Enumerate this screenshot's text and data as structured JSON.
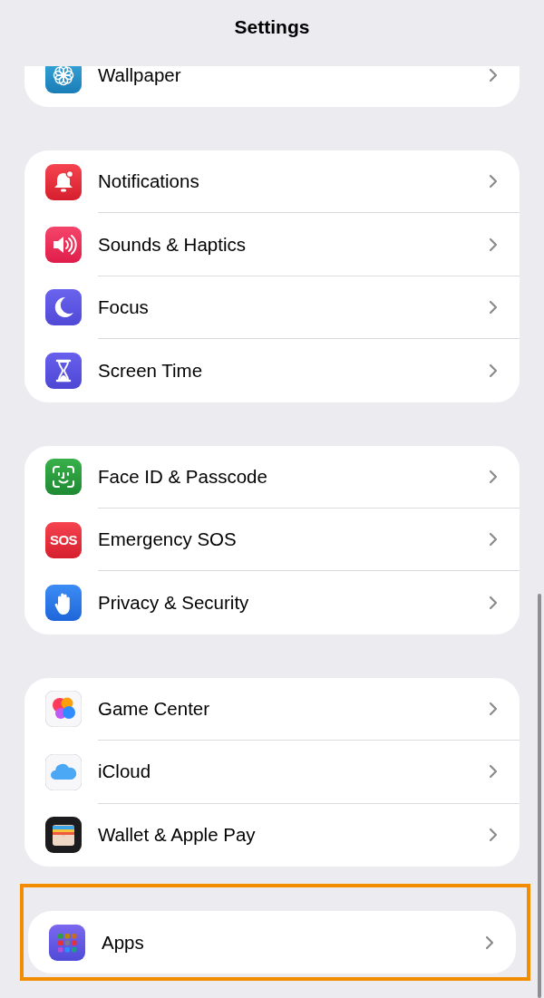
{
  "title": "Settings",
  "groups": [
    {
      "clipped_top": true,
      "highlighted": false,
      "rows": [
        {
          "label": "Wallpaper"
        }
      ]
    },
    {
      "clipped_top": false,
      "highlighted": false,
      "rows": [
        {
          "label": "Notifications"
        },
        {
          "label": "Sounds & Haptics"
        },
        {
          "label": "Focus"
        },
        {
          "label": "Screen Time"
        }
      ]
    },
    {
      "clipped_top": false,
      "highlighted": false,
      "rows": [
        {
          "label": "Face ID & Passcode"
        },
        {
          "label": "Emergency SOS",
          "icon_text": "SOS"
        },
        {
          "label": "Privacy & Security"
        }
      ]
    },
    {
      "clipped_top": false,
      "highlighted": false,
      "rows": [
        {
          "label": "Game Center"
        },
        {
          "label": "iCloud"
        },
        {
          "label": "Wallet & Apple Pay"
        }
      ]
    },
    {
      "clipped_top": false,
      "highlighted": true,
      "rows": [
        {
          "label": "Apps"
        }
      ]
    }
  ]
}
